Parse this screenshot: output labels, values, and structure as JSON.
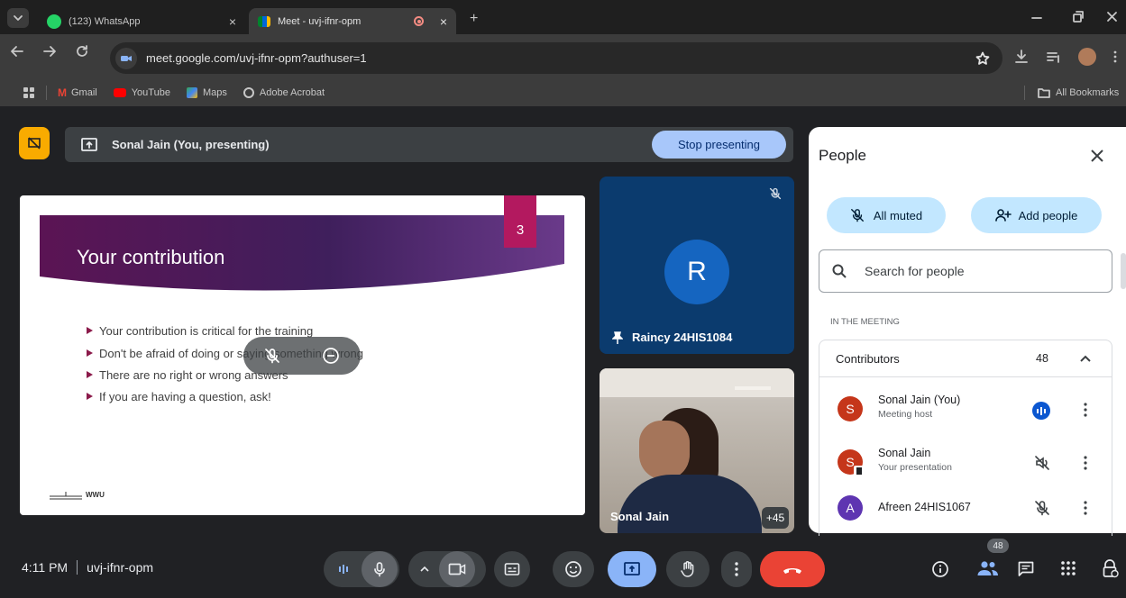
{
  "browser": {
    "tabs": [
      {
        "label": "(123) WhatsApp",
        "close": "×"
      },
      {
        "label": "Meet - uvj-ifnr-opm",
        "close": "×"
      }
    ],
    "new_tab": "+",
    "url": "meet.google.com/uvj-ifnr-opm?authuser=1",
    "bookmarks": [
      "Gmail",
      "YouTube",
      "Maps",
      "Adobe Acrobat"
    ],
    "all_bookmarks": "All Bookmarks"
  },
  "presenting_bar": {
    "label": "Sonal Jain (You, presenting)",
    "stop_button": "Stop presenting"
  },
  "slide": {
    "number": "3",
    "title": "Your contribution",
    "bullets": [
      "Your contribution is critical for the training",
      "Don't be afraid of doing or saying something wrong",
      "There are no right or wrong answers",
      "If you are having a question, ask!"
    ],
    "logo_text": "WWU"
  },
  "tiles": {
    "rainy": {
      "initial": "R",
      "name": "Raincy 24HIS1084"
    },
    "sonal": {
      "name": "Sonal Jain",
      "more_count": "+45"
    }
  },
  "people_panel": {
    "title": "People",
    "all_muted": "All muted",
    "add_people": "Add people",
    "search_placeholder": "Search for people",
    "section_label": "IN THE MEETING",
    "group": {
      "label": "Contributors",
      "count": "48"
    },
    "participants": [
      {
        "initial": "S",
        "name": "Sonal Jain (You)",
        "sub": "Meeting host",
        "color": "#c5361a"
      },
      {
        "initial": "S",
        "name": "Sonal Jain",
        "sub": "Your presentation",
        "color": "#c5361a"
      },
      {
        "initial": "A",
        "name": "Afreen 24HIS1067",
        "sub": "",
        "color": "#5e35b1"
      }
    ]
  },
  "bottom_bar": {
    "time": "4:11 PM",
    "meeting_code": "uvj-ifnr-opm",
    "people_badge": "48"
  },
  "colors": {
    "accent_blue": "#a8c7fa",
    "end_call_red": "#ea4335",
    "present_blue": "#8ab4f8",
    "slide_magenta": "#8b1a4a"
  }
}
